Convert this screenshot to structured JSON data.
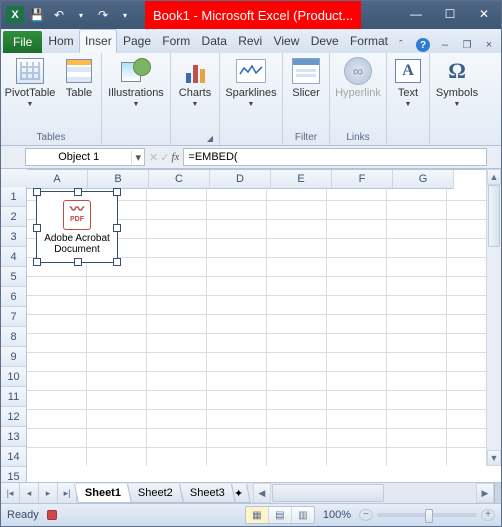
{
  "titlebar": {
    "title": "Book1 - Microsoft Excel (Product...",
    "qat_icons": [
      "excel-logo",
      "save-icon",
      "undo-icon",
      "redo-icon",
      "qat-customize-icon"
    ]
  },
  "ribbon_tabs": {
    "file": "File",
    "items": [
      "Hom",
      "Inser",
      "Page",
      "Form",
      "Data",
      "Revi",
      "View",
      "Deve",
      "Format"
    ],
    "active_index": 1
  },
  "ribbon": {
    "tables": {
      "label": "Tables",
      "pivot": "PivotTable",
      "table": "Table"
    },
    "illustrations": {
      "label": "Illustrations",
      "btn": "Illustrations"
    },
    "charts": {
      "label": "Charts",
      "btn": "Charts"
    },
    "sparklines": {
      "label": "Sparklines",
      "btn": "Sparklines"
    },
    "filter": {
      "label": "Filter",
      "btn": "Slicer"
    },
    "links": {
      "label": "Links",
      "btn": "Hyperlink"
    },
    "text": {
      "label": "Text",
      "btn": "Text"
    },
    "symbols": {
      "label": "Symbols",
      "btn": "Symbols"
    }
  },
  "formula_bar": {
    "name_box": "Object 1",
    "formula": "=EMBED("
  },
  "grid": {
    "columns": [
      "A",
      "B",
      "C",
      "D",
      "E",
      "F",
      "G"
    ],
    "rows": [
      "1",
      "2",
      "3",
      "4",
      "5",
      "6",
      "7",
      "8",
      "9",
      "10",
      "11",
      "12",
      "13",
      "14",
      "15"
    ],
    "embedded_object": {
      "icon_label": "PDF",
      "label": "Adobe Acrobat Document"
    }
  },
  "sheet_tabs": [
    "Sheet1",
    "Sheet2",
    "Sheet3"
  ],
  "sheet_active_index": 0,
  "status": {
    "state": "Ready",
    "zoom": "100%"
  }
}
